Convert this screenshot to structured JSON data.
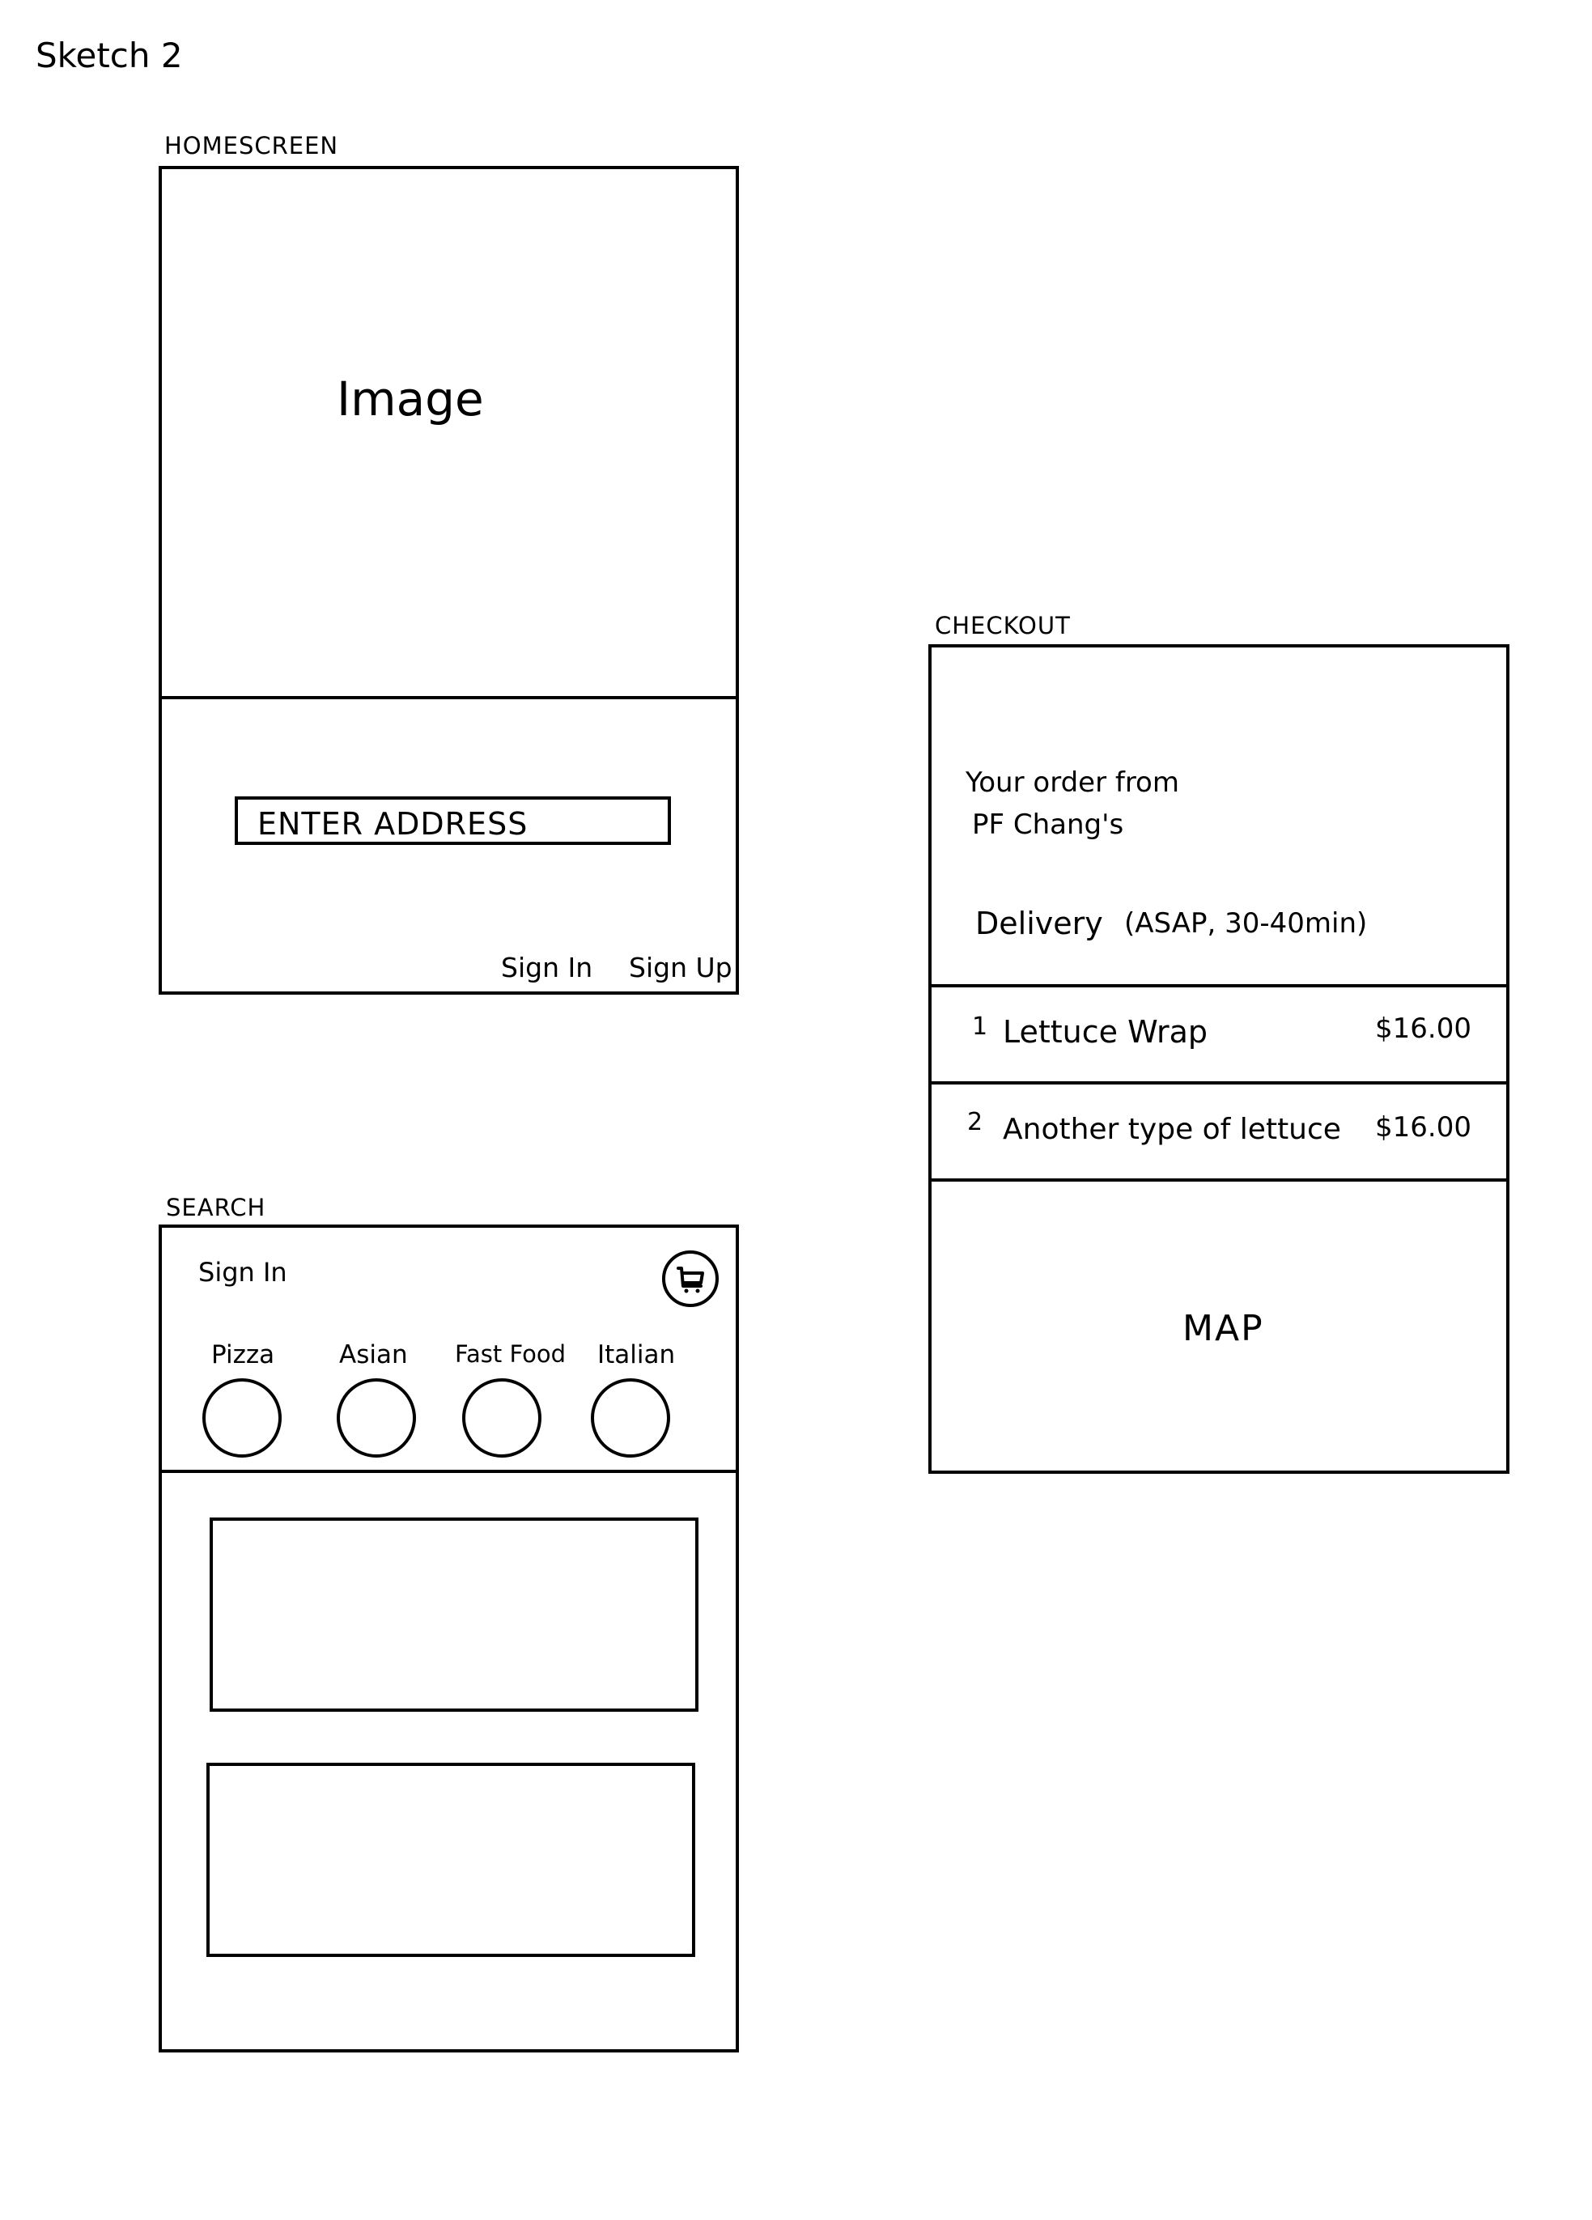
{
  "sheet": {
    "title": "Sketch 2"
  },
  "homescreen": {
    "heading": "HOMESCREEN",
    "image_placeholder": "Image",
    "address_input": "ENTER ADDRESS",
    "sign_in": "Sign In",
    "sign_up": "Sign Up"
  },
  "search": {
    "heading": "SEARCH",
    "sign_in": "Sign In",
    "cart_icon": "cart-icon",
    "categories": [
      {
        "label": "Pizza"
      },
      {
        "label": "Asian"
      },
      {
        "label": "Fast Food"
      },
      {
        "label": "Italian"
      }
    ]
  },
  "checkout": {
    "heading": "CHECKOUT",
    "order_from_line1": "Your order from",
    "order_from_line2": "PF Chang's",
    "delivery_label": "Delivery",
    "delivery_detail": "(ASAP, 30-40min)",
    "items": [
      {
        "qty": "1",
        "name": "Lettuce Wrap",
        "price": "$16.00"
      },
      {
        "qty": "2",
        "name": "Another type of lettuce",
        "price": "$16.00"
      }
    ],
    "map_placeholder": "MAP"
  }
}
